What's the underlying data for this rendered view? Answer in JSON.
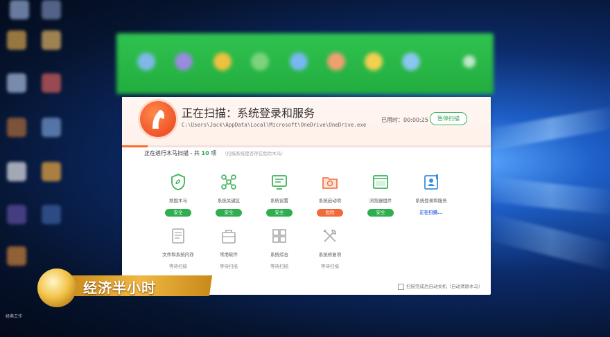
{
  "scan": {
    "title": "正在扫描：系统登录和服务",
    "path": "C:\\Users\\Jack\\AppData\\Local\\Microsoft\\OneDrive\\OneDrive.exe",
    "elapsed": "已用时：00:00:25",
    "pause_label": "暂停扫描",
    "progress": 0.07
  },
  "subheader": {
    "prefix": "正在进行木马扫描 - 共",
    "count": "10",
    "suffix": "项",
    "hint": "（扫描系统是否存在危险木马）"
  },
  "items": [
    {
      "label": "顽固木马",
      "status": "安全",
      "state": "safe",
      "icon": "shield-icon"
    },
    {
      "label": "系统关键区",
      "status": "安全",
      "state": "safe",
      "icon": "nodes-icon"
    },
    {
      "label": "系统设置",
      "status": "安全",
      "state": "safe",
      "icon": "settings-monitor-icon"
    },
    {
      "label": "系统启动项",
      "status": "危险",
      "state": "danger",
      "icon": "startup-folder-icon"
    },
    {
      "label": "浏览器组件",
      "status": "安全",
      "state": "safe",
      "icon": "browser-window-icon"
    },
    {
      "label": "系统登录和服务",
      "status": "正在扫描...",
      "state": "scanning",
      "icon": "login-service-icon"
    },
    {
      "label": "文件和系统内存",
      "status": "等待扫描",
      "state": "wait",
      "icon": "file-memory-icon"
    },
    {
      "label": "常用软件",
      "status": "等待扫描",
      "state": "wait",
      "icon": "software-icon"
    },
    {
      "label": "系统综合",
      "status": "等待扫描",
      "state": "wait",
      "icon": "windows-icon"
    },
    {
      "label": "系统修复项",
      "status": "等待扫描",
      "state": "wait",
      "icon": "repair-tools-icon"
    }
  ],
  "footer": {
    "checkbox_label": "扫描完成后自动关机（自动清除木马）"
  },
  "overlay": {
    "channel_name": "经济半小时",
    "corner_text": "经典工作"
  },
  "colors": {
    "accent_green": "#2eae4e",
    "danger_orange": "#f2693a",
    "scan_blue": "#3a6fe0",
    "logo_orange": "#f0542a"
  }
}
